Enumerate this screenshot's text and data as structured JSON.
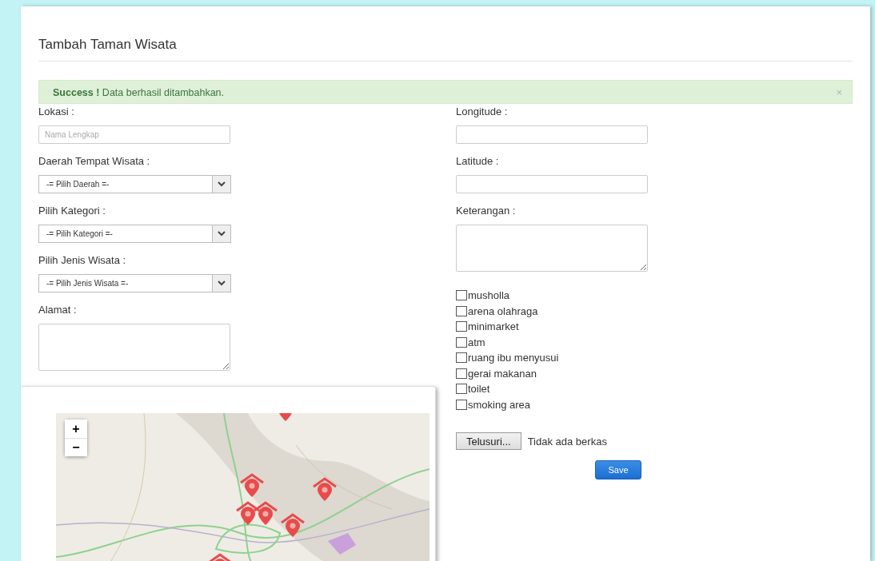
{
  "title": "Tambah Taman Wisata",
  "alert": {
    "strong": "Success !",
    "message": "Data berhasil ditambahkan.",
    "close": "×"
  },
  "left_fields": [
    {
      "kind": "text",
      "label": "Lokasi :",
      "placeholder": "Nama Lengkap"
    },
    {
      "kind": "select",
      "label": "Daerah Tempat Wisata :",
      "value": "-= Pilih Daerah =-"
    },
    {
      "kind": "select",
      "label": "Pilih Kategori :",
      "value": "-= Pilih Kategori =-"
    },
    {
      "kind": "select",
      "label": "Pilih Jenis Wisata :",
      "value": "-= Pilih Jenis Wisata =-"
    },
    {
      "kind": "textarea",
      "label": "Alamat :"
    }
  ],
  "map": {
    "zoom_in": "+",
    "zoom_out": "−"
  },
  "right_fields": [
    {
      "kind": "text",
      "label": "Longitude :"
    },
    {
      "kind": "text",
      "label": "Latitude :"
    },
    {
      "kind": "textarea",
      "label": "Keterangan :"
    }
  ],
  "facilities": [
    {
      "label": "musholla",
      "checked": false
    },
    {
      "label": "arena olahraga",
      "checked": false
    },
    {
      "label": "minimarket",
      "checked": false
    },
    {
      "label": "atm",
      "checked": false
    },
    {
      "label": "ruang ibu menyusui",
      "checked": false
    },
    {
      "label": "gerai makanan",
      "checked": false
    },
    {
      "label": "toilet",
      "checked": false
    },
    {
      "label": "smoking area",
      "checked": false
    }
  ],
  "file": {
    "button": "Telusuri...",
    "status": "Tidak ada berkas"
  },
  "save_button": "Save"
}
